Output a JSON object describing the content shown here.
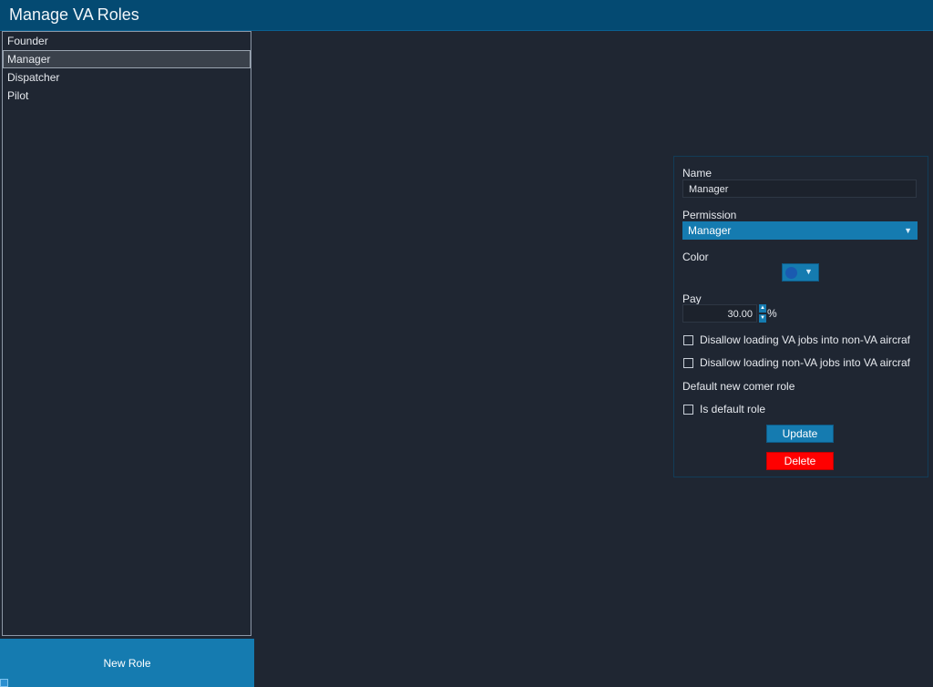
{
  "window": {
    "title": "Manage VA Roles"
  },
  "roles": {
    "items": [
      "Founder",
      "Manager",
      "Dispatcher",
      "Pilot"
    ],
    "selected": "Manager"
  },
  "new_role_button": "New Role",
  "form": {
    "name_label": "Name",
    "name_value": "Manager",
    "permission_label": "Permission",
    "permission_value": "Manager",
    "color_label": "Color",
    "color_value": "#1a5ab0",
    "pay_label": "Pay",
    "pay_value": "30.00",
    "pay_unit": "%",
    "checkbox_disallow_va_into_nonva": "Disallow loading VA jobs into non-VA aircraf",
    "checkbox_disallow_nonva_into_va": "Disallow loading non-VA jobs into VA aircraf",
    "default_section_label": "Default new comer role",
    "checkbox_is_default": "Is default role",
    "update_button": "Update",
    "delete_button": "Delete"
  },
  "colors": {
    "titlebar": "#044a72",
    "background": "#1f2632",
    "accent": "#157bb0",
    "danger": "#ff0000"
  }
}
